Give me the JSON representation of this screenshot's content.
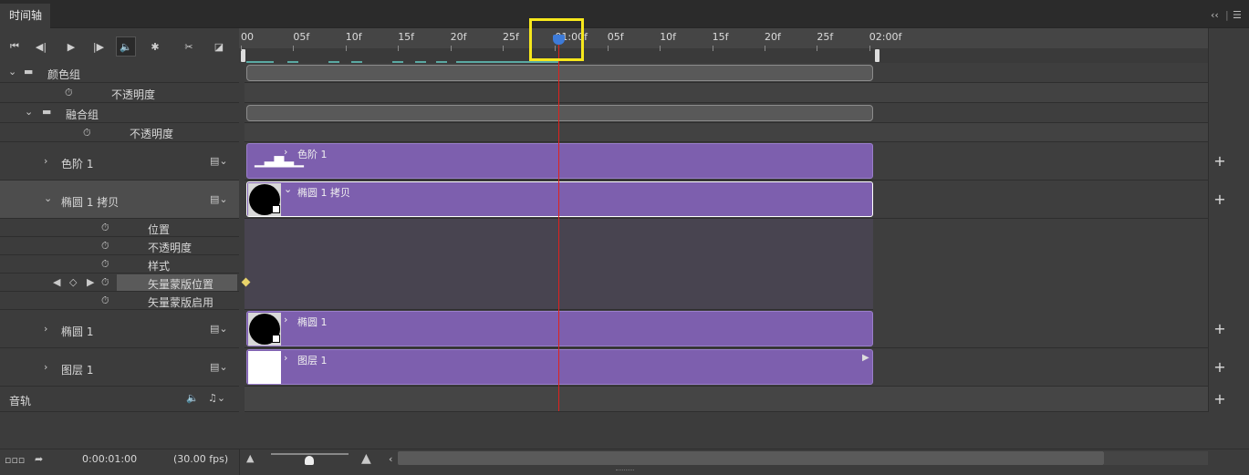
{
  "panel": {
    "tab_title": "时间轴",
    "collapse_icon": "double-chevron-left-icon",
    "menu_icon": "hamburger-icon"
  },
  "toolbar": {
    "buttons": [
      "go-to-first-frame-icon",
      "previous-frame-icon",
      "play-icon",
      "next-frame-icon",
      "audio-icon",
      "gear-icon",
      "scissors-icon",
      "transition-icon"
    ]
  },
  "ruler": {
    "ticks": [
      "00",
      "05f",
      "10f",
      "15f",
      "20f",
      "25f",
      "01:00f",
      "05f",
      "10f",
      "15f",
      "20f",
      "25f",
      "02:00f"
    ]
  },
  "layers": {
    "color_group": {
      "name": "颜色组",
      "opacity": "不透明度"
    },
    "blend_group": {
      "name": "融合组",
      "opacity": "不透明度"
    },
    "levels": {
      "name": "色阶 1"
    },
    "ellipse_copy": {
      "name": "椭圆 1 拷贝",
      "props": [
        "位置",
        "不透明度",
        "样式",
        "矢量蒙版位置",
        "矢量蒙版启用"
      ]
    },
    "ellipse": {
      "name": "椭圆 1"
    },
    "layer1": {
      "name": "图层 1"
    },
    "audio": {
      "name": "音轨"
    }
  },
  "clips": {
    "levels": "色阶 1",
    "ellipse_copy": "椭圆 1 拷贝",
    "ellipse": "椭圆 1",
    "layer1": "图层 1"
  },
  "bottom": {
    "timecode": "0:00:01:00",
    "fps": "(30.00 fps)"
  },
  "colors": {
    "clip": "#7d5fae",
    "playhead": "#e0211d",
    "highlight": "#f6e71c",
    "keyframe": "#e8d36a"
  }
}
